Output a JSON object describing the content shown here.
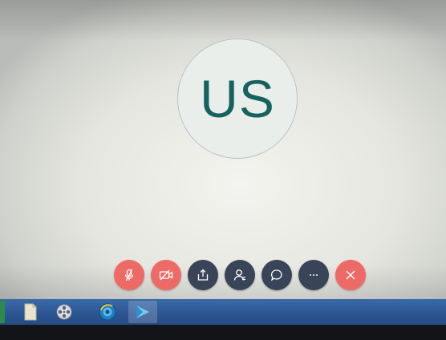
{
  "avatar": {
    "initials": "US"
  },
  "controls": [
    {
      "id": "mic",
      "icon": "mic-off-icon",
      "color": "#ee6a67"
    },
    {
      "id": "video",
      "icon": "video-off-icon",
      "color": "#ee6a67"
    },
    {
      "id": "share",
      "icon": "share-icon",
      "color": "#3a4459"
    },
    {
      "id": "participants",
      "icon": "participants-icon",
      "color": "#3a4459"
    },
    {
      "id": "chat",
      "icon": "chat-icon",
      "color": "#3a4459"
    },
    {
      "id": "more",
      "icon": "more-icon",
      "color": "#3a4459"
    },
    {
      "id": "end",
      "icon": "close-icon",
      "color": "#ee6a67"
    }
  ],
  "taskbar": {
    "items": [
      {
        "icon": "file-explorer-icon"
      },
      {
        "icon": "media-player-icon"
      },
      {
        "icon": "browser-icon"
      },
      {
        "icon": "meeting-app-icon",
        "active": true
      }
    ]
  }
}
